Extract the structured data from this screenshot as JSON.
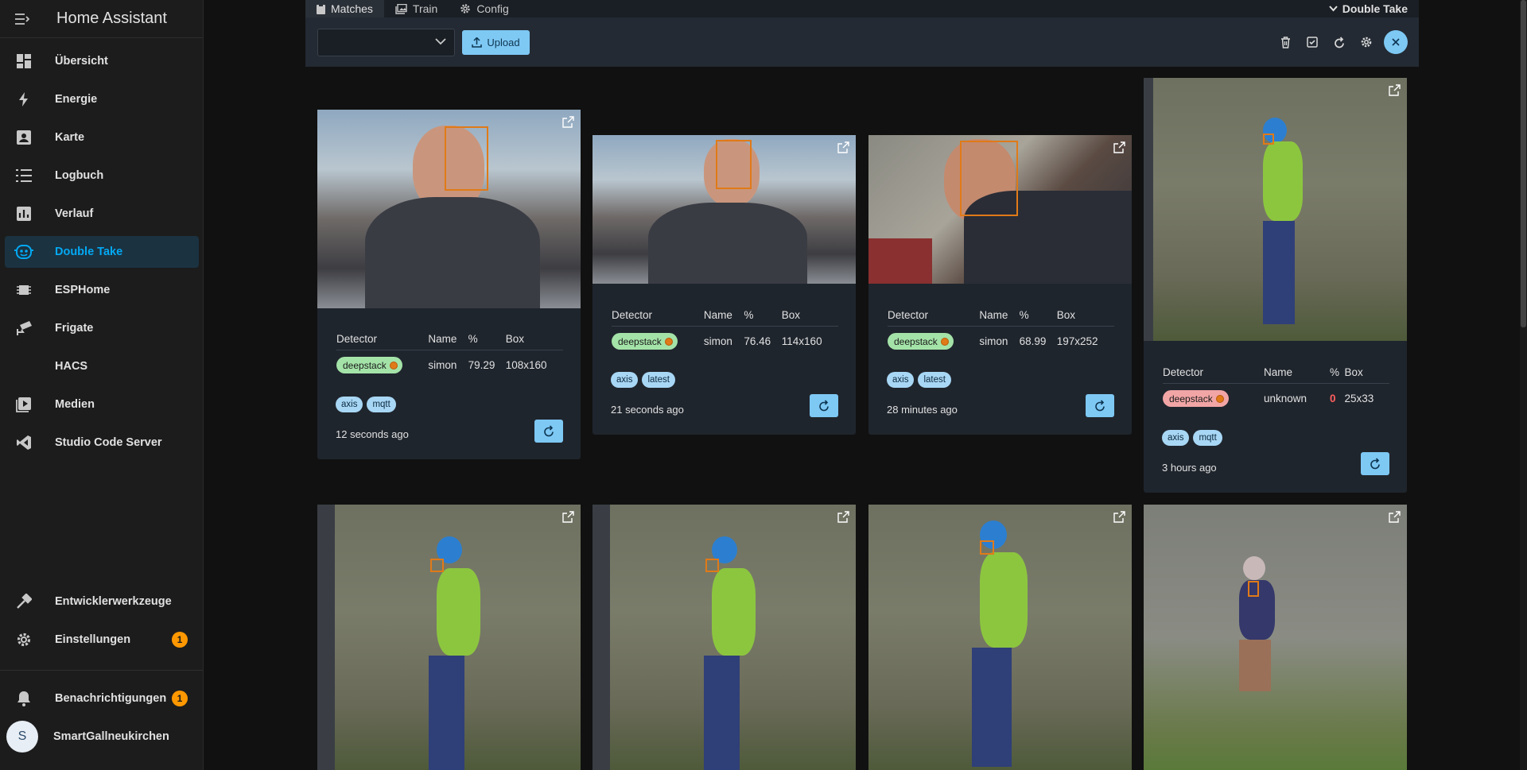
{
  "app": {
    "title": "Home Assistant"
  },
  "sidebar": {
    "items": [
      {
        "label": "Übersicht",
        "icon": "dashboard-icon"
      },
      {
        "label": "Energie",
        "icon": "lightning-icon"
      },
      {
        "label": "Karte",
        "icon": "account-box-icon"
      },
      {
        "label": "Logbuch",
        "icon": "list-icon"
      },
      {
        "label": "Verlauf",
        "icon": "chart-icon"
      },
      {
        "label": "Double Take",
        "icon": "robot-face-icon",
        "active": true
      },
      {
        "label": "ESPHome",
        "icon": "chip-icon"
      },
      {
        "label": "Frigate",
        "icon": "cctv-icon"
      },
      {
        "label": "HACS",
        "icon": ""
      },
      {
        "label": "Medien",
        "icon": "play-box-icon"
      },
      {
        "label": "Studio Code Server",
        "icon": "vscode-icon"
      }
    ],
    "bottom": [
      {
        "label": "Entwicklerwerkzeuge",
        "icon": "hammer-icon"
      },
      {
        "label": "Einstellungen",
        "icon": "cog-icon",
        "badge": "1"
      }
    ],
    "notifications": {
      "label": "Benachrichtigungen",
      "badge": "1"
    },
    "user": {
      "label": "SmartGallneukirchen",
      "initial": "S"
    }
  },
  "tabs": [
    {
      "label": "Matches",
      "icon": "clipboard-icon",
      "active": true
    },
    {
      "label": "Train",
      "icon": "images-icon"
    },
    {
      "label": "Config",
      "icon": "cog-icon"
    }
  ],
  "addon_title": "Double Take",
  "toolbar": {
    "upload_label": "Upload",
    "select_value": ""
  },
  "table_headers": {
    "detector": "Detector",
    "name": "Name",
    "pct": "%",
    "box": "Box"
  },
  "cards": [
    {
      "detector": "deepstack",
      "name": "simon",
      "pct": "79.29",
      "box": "108x160",
      "tags": [
        "axis",
        "mqtt"
      ],
      "time": "12 seconds ago",
      "match": true
    },
    {
      "detector": "deepstack",
      "name": "simon",
      "pct": "76.46",
      "box": "114x160",
      "tags": [
        "axis",
        "latest"
      ],
      "time": "21 seconds ago",
      "match": true
    },
    {
      "detector": "deepstack",
      "name": "simon",
      "pct": "68.99",
      "box": "197x252",
      "tags": [
        "axis",
        "latest"
      ],
      "time": "28 minutes ago",
      "match": true
    },
    {
      "detector": "deepstack",
      "name": "unknown",
      "pct": "0",
      "box": "25x33",
      "tags": [
        "axis",
        "mqtt"
      ],
      "time": "3 hours ago",
      "match": false
    }
  ],
  "colors": {
    "accent": "#03a9f4",
    "button": "#7ec8f4",
    "match_chip": "#a4e3a8",
    "unknown_chip": "#f2a5a5",
    "badge": "#ff9800"
  }
}
